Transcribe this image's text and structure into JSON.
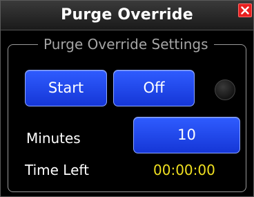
{
  "window": {
    "title": "Purge Override",
    "close_icon": "close-icon"
  },
  "settings": {
    "legend": "Purge Override Settings",
    "start_label": "Start",
    "off_label": "Off",
    "indicator_state": "off",
    "minutes_label": "Minutes",
    "minutes_value": "10",
    "time_left_label": "Time Left",
    "time_left_value": "00:00:00"
  },
  "colors": {
    "button_blue": "#1f48f0",
    "time_left_yellow": "#f0e020",
    "close_red": "#e81f1f"
  }
}
